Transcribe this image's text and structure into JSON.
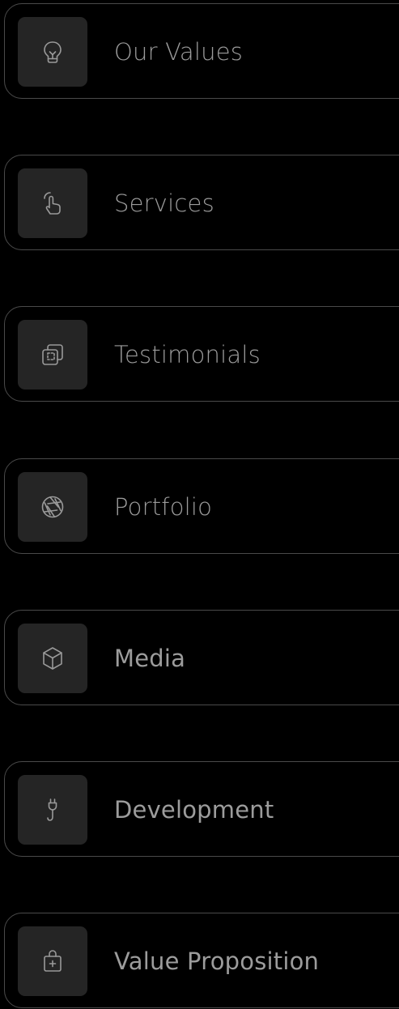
{
  "nav": {
    "items": [
      {
        "label": "Our Values",
        "icon": "lightbulb-icon"
      },
      {
        "label": "Services",
        "icon": "pointer-hand-icon"
      },
      {
        "label": "Testimonials",
        "icon": "overlapping-squares-icon"
      },
      {
        "label": "Portfolio",
        "icon": "aperture-icon"
      },
      {
        "label": "Media",
        "icon": "cube-icon"
      },
      {
        "label": "Development",
        "icon": "plug-icon"
      },
      {
        "label": "Value Proposition",
        "icon": "shopping-bag-plus-icon"
      }
    ]
  },
  "colors": {
    "background": "#000000",
    "card_border": "#4a4a4a",
    "icon_tile": "#252525",
    "label": "#9c9c9c",
    "icon_stroke": "#9a9a9a"
  }
}
